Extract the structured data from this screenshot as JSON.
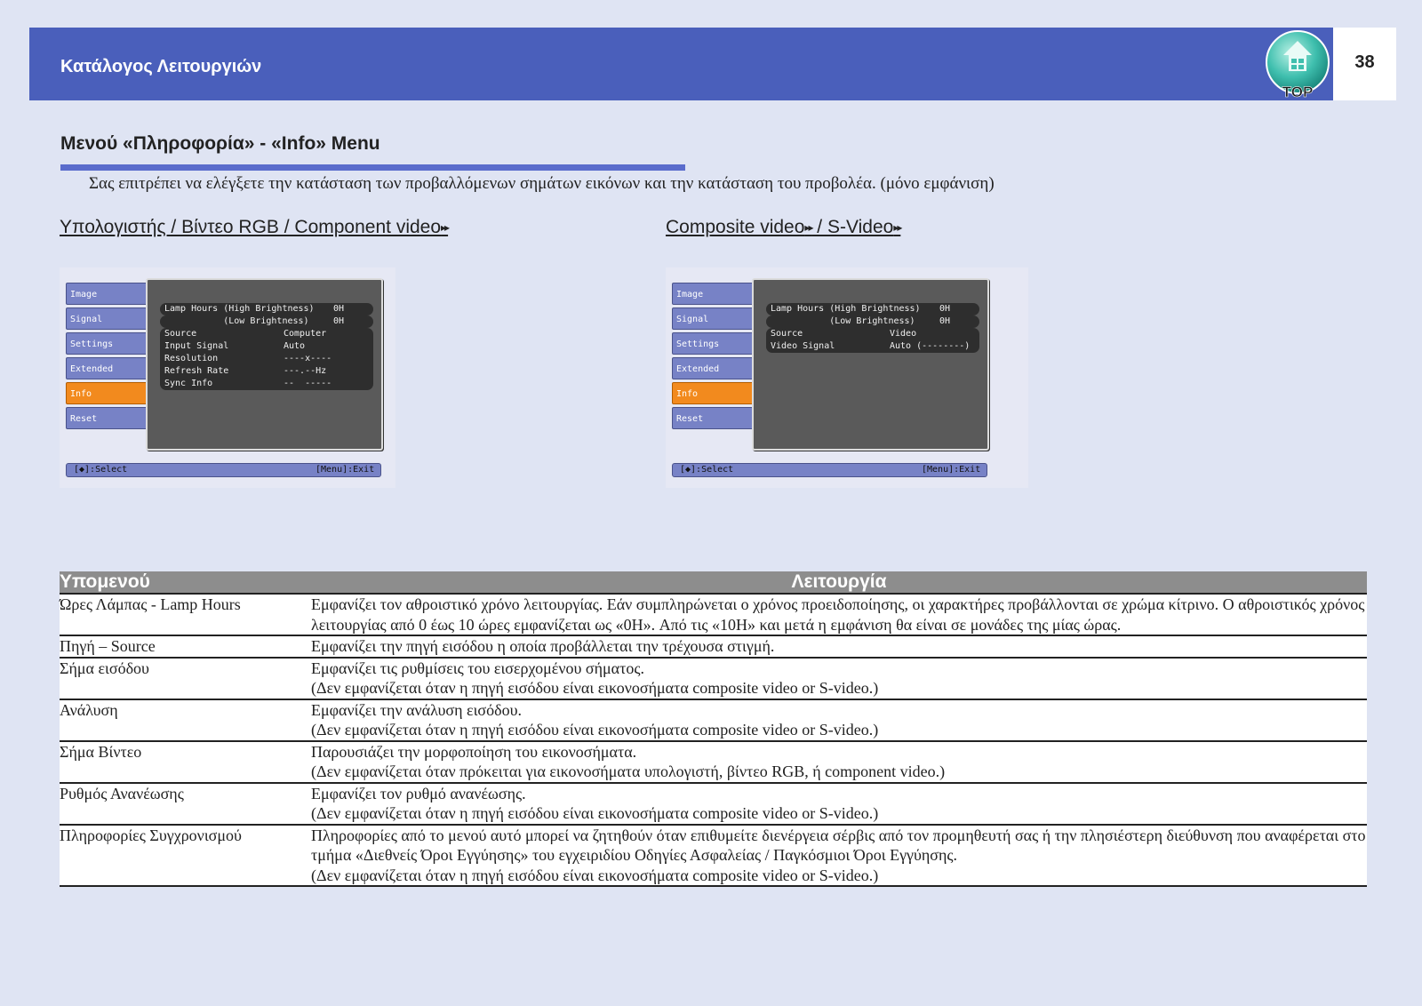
{
  "header": {
    "title": "Κατάλογος Λειτουργιών",
    "page_number": "38",
    "top_label": "TOP"
  },
  "section": {
    "title": "Μενού «Πληροφορία» - «Info» Menu",
    "intro": "Σας επιτρέπει να ελέγξετε την κατάσταση των προβαλλόμενων σημάτων εικόνων και την κατάσταση του προβολέα. (μόνο εμφάνιση)"
  },
  "subheads": {
    "left": "Υπολογιστής / Βίντεο RGB / Component video",
    "right_a": "Composite video",
    "right_b": " / S-Video",
    "arrow": "▸▸"
  },
  "osd_left": {
    "tabs": [
      "Image",
      "Signal",
      "Settings",
      "Extended",
      "Info",
      "Reset"
    ],
    "active_tab": "Info",
    "rows": [
      {
        "label": "Lamp Hours (High Brightness)",
        "value": "0H"
      },
      {
        "label": "           (Low Brightness)",
        "value": "0H"
      },
      {
        "label": "Source",
        "value": "Computer"
      },
      {
        "label": "Input Signal",
        "value": "Auto"
      },
      {
        "label": "Resolution",
        "value": "----x----"
      },
      {
        "label": "Refresh Rate",
        "value": "---.--Hz"
      },
      {
        "label": "Sync Info",
        "value": "--  -----"
      }
    ],
    "footer_left": "[◆]:Select",
    "footer_right": "[Menu]:Exit"
  },
  "osd_right": {
    "tabs": [
      "Image",
      "Signal",
      "Settings",
      "Extended",
      "Info",
      "Reset"
    ],
    "active_tab": "Info",
    "rows": [
      {
        "label": "Lamp Hours (High Brightness)",
        "value": "0H"
      },
      {
        "label": "           (Low Brightness)",
        "value": "0H"
      },
      {
        "label": "Source",
        "value": "Video"
      },
      {
        "label": "Video Signal",
        "value": "Auto (--------)"
      }
    ],
    "footer_left": "[◆]:Select",
    "footer_right": "[Menu]:Exit"
  },
  "table": {
    "headers": [
      "Υπομενού",
      "Λειτουργία"
    ],
    "rows": [
      {
        "submenu": "Ώρες Λάμπας - Lamp Hours",
        "function": "Εμφανίζει τον αθροιστικό χρόνο λειτουργίας. Εάν συμπληρώνεται ο χρόνος προειδοποίησης, οι χαρακτήρες προβάλλονται σε χρώμα κίτρινο. Ο αθροιστικός χρόνος λειτουργίας από 0 έως 10 ώρες εμφανίζεται ως «0H». Από τις «10H» και μετά η εμφάνιση θα είναι σε μονάδες της μίας ώρας."
      },
      {
        "submenu": "Πηγή – Source",
        "function": "Εμφανίζει την πηγή εισόδου η οποία προβάλλεται την τρέχουσα στιγμή."
      },
      {
        "submenu": "Σήμα εισόδου",
        "function": "Εμφανίζει τις ρυθμίσεις του εισερχομένου σήματος.",
        "note": "(Δεν εμφανίζεται όταν η πηγή εισόδου είναι εικονοσήματα composite video or S-video.)"
      },
      {
        "submenu": "Ανάλυση",
        "function": "Εμφανίζει την ανάλυση εισόδου.",
        "note": "(Δεν εμφανίζεται όταν η πηγή εισόδου είναι εικονοσήματα composite video or S-video.)"
      },
      {
        "submenu": "Σήμα Βίντεο",
        "function": "Παρουσιάζει την μορφοποίηση του εικονοσήματα.",
        "note": "(Δεν εμφανίζεται όταν πρόκειται για εικονοσήματα υπολογιστή, βίντεο RGB, ή component video.)"
      },
      {
        "submenu": "Ρυθμός Ανανέωσης",
        "function": "Εμφανίζει τον ρυθμό ανανέωσης.",
        "note": "(Δεν εμφανίζεται όταν η πηγή εισόδου είναι εικονοσήματα composite video or S-video.)"
      },
      {
        "submenu": "Πληροφορίες Συγχρονισμού",
        "function": "Πληροφορίες από το μενού αυτό μπορεί να ζητηθούν όταν επιθυμείτε διενέργεια σέρβις από τον προμηθευτή σας ή την πλησιέστερη διεύθυνση που αναφέρεται στο τμήμα «Διεθνείς Όροι Εγγύησης» του εγχειριδίου Οδηγίες Ασφαλείας / Παγκόσμιοι Όροι Εγγύησης.",
        "note": "(Δεν εμφανίζεται όταν η πηγή εισόδου είναι εικονοσήματα composite video or S-video.)"
      }
    ]
  }
}
